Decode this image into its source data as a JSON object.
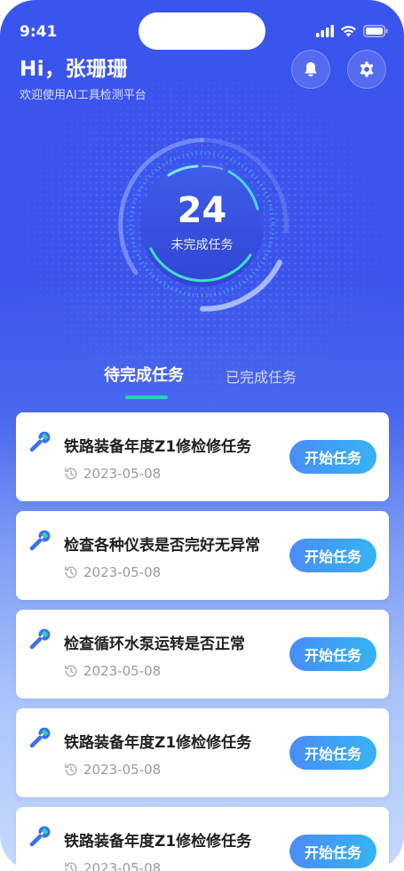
{
  "status_bar": {
    "time": "9:41"
  },
  "header": {
    "greeting": "Hi，张珊珊",
    "subtitle": "欢迎使用AI工具检测平台"
  },
  "summary": {
    "count": "24",
    "label": "未完成任务"
  },
  "tabs": [
    {
      "label": "待完成任务",
      "active": true
    },
    {
      "label": "已完成任务",
      "active": false
    }
  ],
  "tasks": [
    {
      "title": "铁路装备年度Z1修检修任务",
      "date": "2023-05-08",
      "action": "开始任务"
    },
    {
      "title": "检查各种仪表是否完好无异常",
      "date": "2023-05-08",
      "action": "开始任务"
    },
    {
      "title": "检查循环水泵运转是否正常",
      "date": "2023-05-08",
      "action": "开始任务"
    },
    {
      "title": "铁路装备年度Z1修检修任务",
      "date": "2023-05-08",
      "action": "开始任务"
    },
    {
      "title": "铁路装备年度Z1修检修任务",
      "date": "2023-05-08",
      "action": "开始任务"
    }
  ],
  "colors": {
    "primary_blue": "#3a54ee",
    "accent_teal": "#27d2b3",
    "button_gradient_start": "#4a8cf7",
    "button_gradient_end": "#35b4f3"
  }
}
